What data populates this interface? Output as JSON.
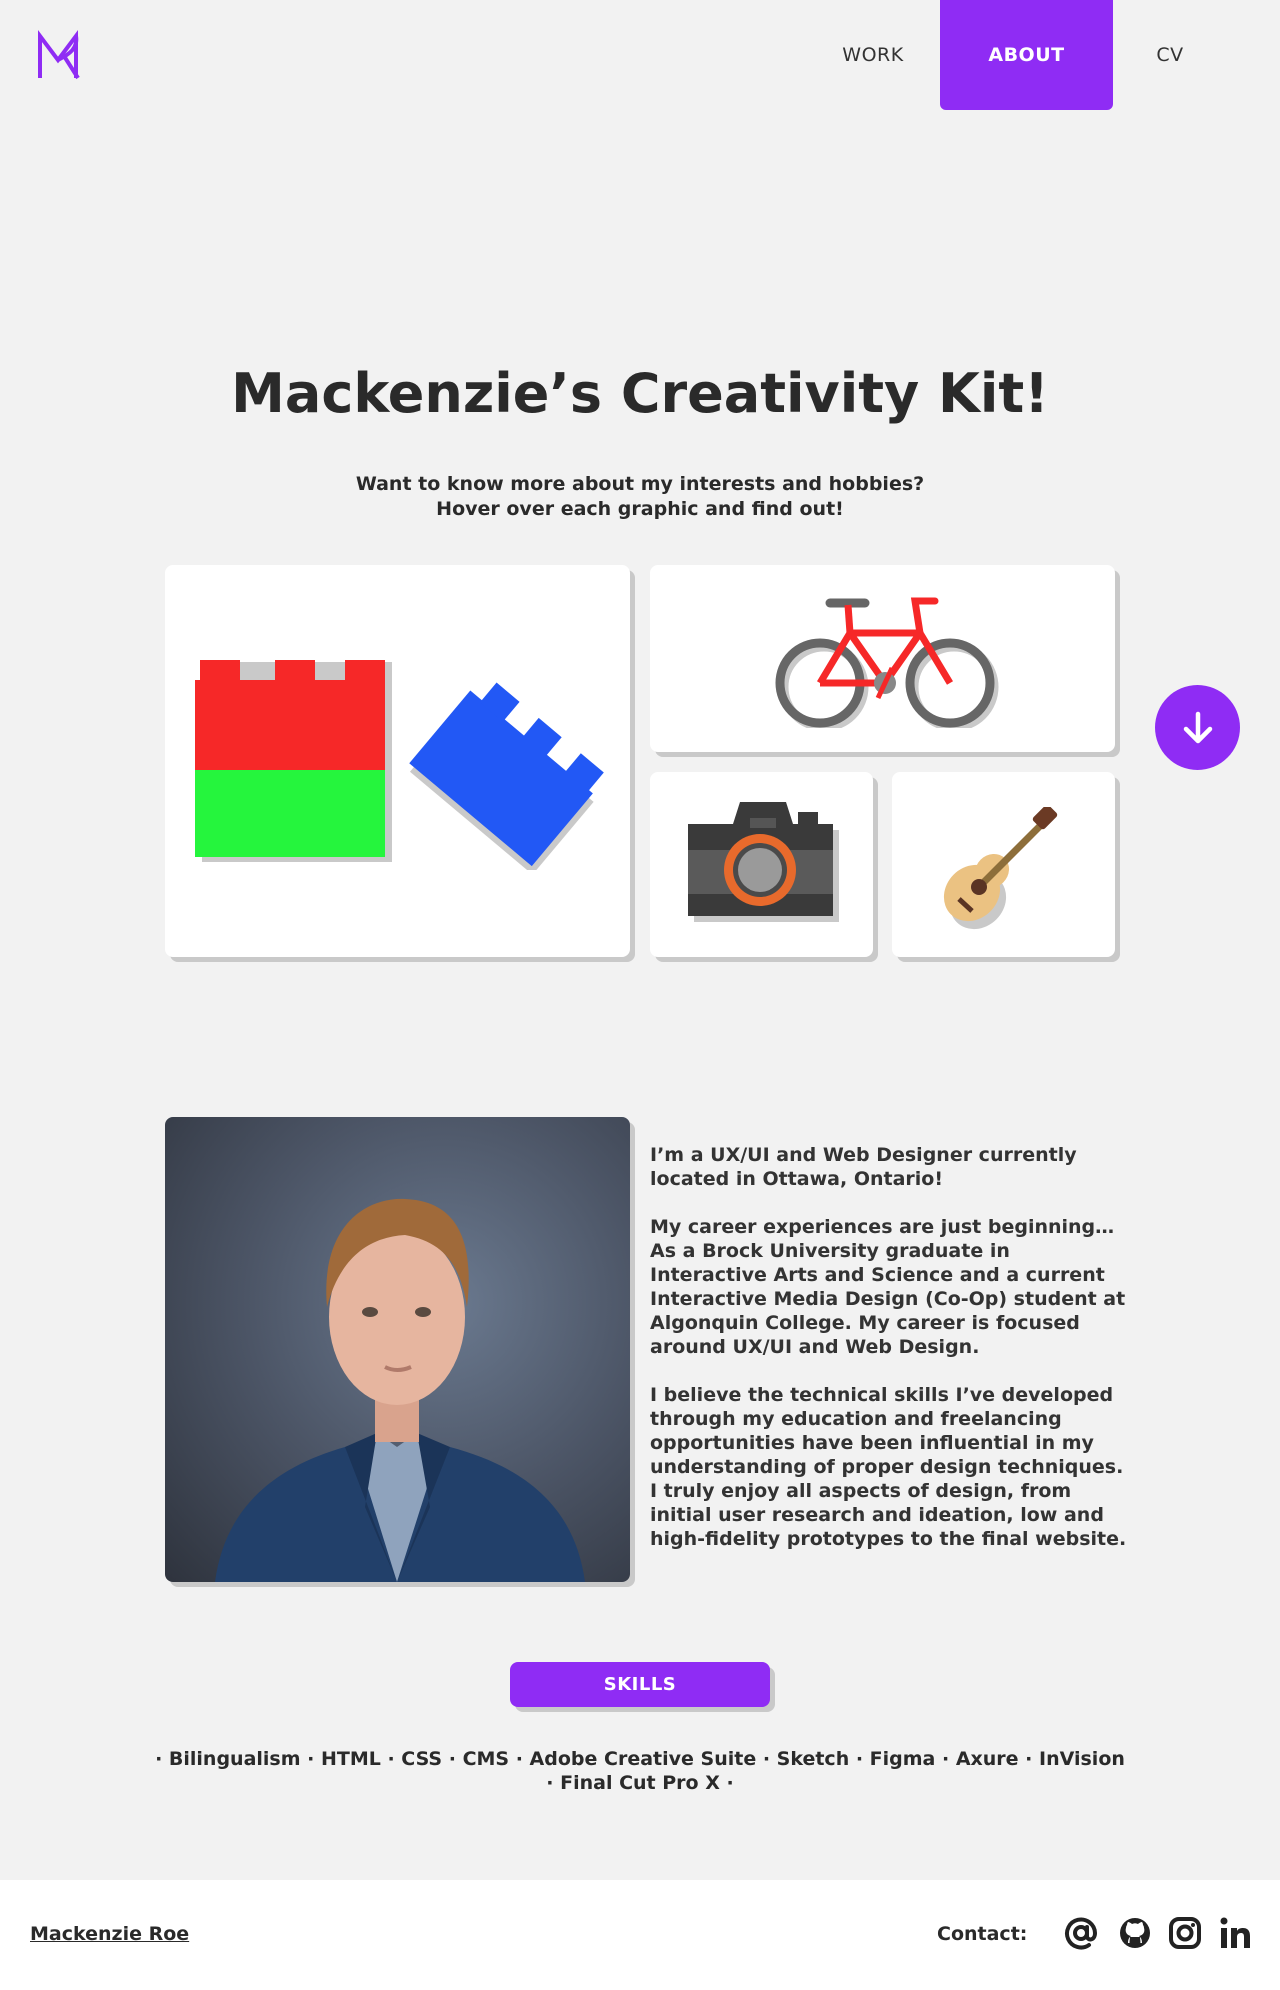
{
  "header": {
    "logo_alt": "MR",
    "nav": {
      "work": "WORK",
      "about": "ABOUT",
      "cv": "CV"
    },
    "active": "about",
    "accent_color": "#8f2cf4"
  },
  "hero": {
    "title": "Mackenzie’s Creativity Kit!",
    "subtitle_line1": "Want to know more about my interests and hobbies?",
    "subtitle_line2": "Hover over each graphic and find out!",
    "cards": [
      "lego-icon",
      "bicycle-icon",
      "camera-icon",
      "guitar-icon"
    ],
    "scroll_button_icon": "arrow-down-icon"
  },
  "about": {
    "photo": "portrait-photo",
    "paragraphs": [
      "I’m a UX/UI and Web Designer currently located in Ottawa, Ontario!",
      "My career experiences are just beginning… As a Brock University graduate in Interactive Arts and Science and a current Interactive Media Design (Co-Op) student at Algonquin College. My career is focused around UX/UI and Web Design.",
      "I believe the technical skills I’ve developed through my education and freelancing opportunities have been influential in my understanding of proper design techniques. I truly enjoy all aspects of design, from initial user research and ideation, low and high-fidelity prototypes to the final website."
    ]
  },
  "skills": {
    "button_label": "SKILLS",
    "line1": "· Bilingualism · HTML · CSS · CMS · Adobe Creative Suite · Sketch · Figma · Axure · InVision",
    "line2": "· Final Cut Pro X ·"
  },
  "footer": {
    "name": "Mackenzie Roe",
    "contact_label": "Contact:",
    "icons": [
      "email-at-icon",
      "github-icon",
      "instagram-icon",
      "linkedin-icon"
    ]
  }
}
